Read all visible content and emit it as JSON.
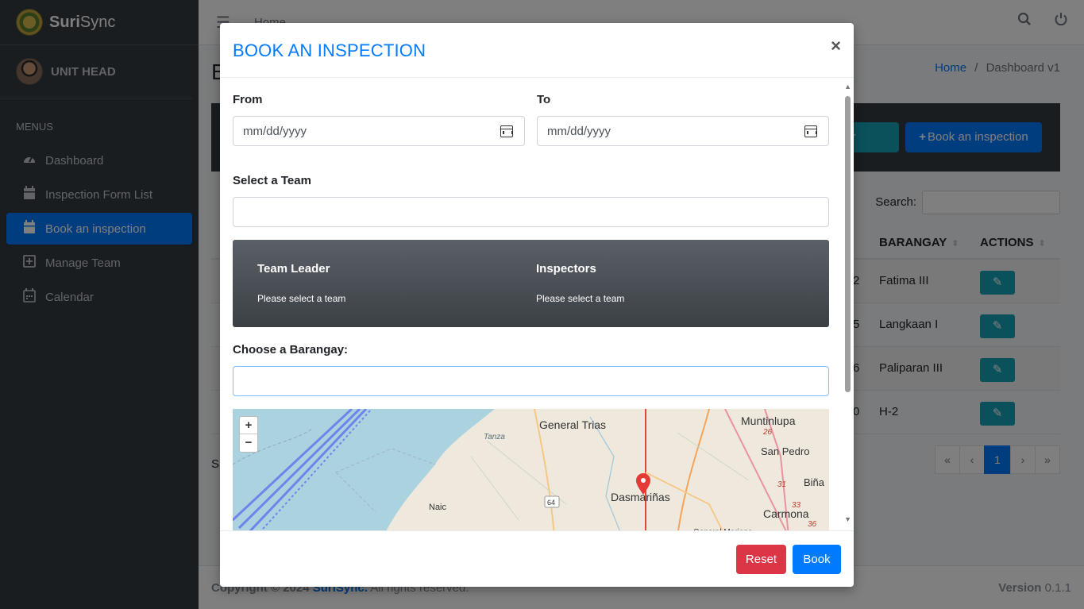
{
  "app": {
    "brand_prefix": "Suri",
    "brand_suffix": "Sync",
    "user_role": "UNIT HEAD"
  },
  "sidebar": {
    "menu_header": "MENUS",
    "items": [
      {
        "label": "Dashboard",
        "icon": "gauge-icon"
      },
      {
        "label": "Inspection Form List",
        "icon": "calendar-icon"
      },
      {
        "label": "Book an inspection",
        "icon": "calendar-icon",
        "active": true
      },
      {
        "label": "Manage Team",
        "icon": "plus-square-icon"
      },
      {
        "label": "Calendar",
        "icon": "calendar-icon"
      }
    ]
  },
  "topbar": {
    "home_label": "Home"
  },
  "page": {
    "title_initial": "B",
    "breadcrumb_home": "Home",
    "breadcrumb_sep": "/",
    "breadcrumb_current": "Dashboard v1",
    "calendar_button_partial": "lendar",
    "book_button": "Book an inspection",
    "search_label": "Search:",
    "table": {
      "headers": [
        "BARANGAY",
        "ACTIONS"
      ],
      "rows": [
        {
          "num_tail": "2",
          "barangay": "Fatima III"
        },
        {
          "num_tail": "5",
          "barangay": "Langkaan I"
        },
        {
          "num_tail": "6",
          "barangay": "Paliparan III"
        },
        {
          "num_tail": "0",
          "barangay": "H-2"
        }
      ]
    },
    "show_partial": "Sl",
    "pager": [
      "«",
      "‹",
      "1",
      "›",
      "»"
    ]
  },
  "footer": {
    "copyright": "Copyright © 2024 ",
    "brand": "SuriSync.",
    "rights": " All rights reserved.",
    "version_label": "Version",
    "version_value": " 0.1.1"
  },
  "modal": {
    "title": "BOOK AN INSPECTION",
    "close": "×",
    "from_label": "From",
    "to_label": "To",
    "from_placeholder": "mm/dd/yyyy",
    "to_placeholder": "mm/dd/yyyy",
    "team_label": "Select a Team",
    "team_value": "",
    "team_leader_heading": "Team Leader",
    "team_leader_value": "Please select a team",
    "inspectors_heading": "Inspectors",
    "inspectors_value": "Please select a team",
    "barangay_label": "Choose a Barangay:",
    "barangay_value": "",
    "map": {
      "zoom_in": "+",
      "zoom_out": "−",
      "places": [
        "General Trias",
        "Muntinlupa",
        "San Pedro",
        "Dasmariñas",
        "Carmona",
        "Naic",
        "Tanza",
        "Biña",
        "General Mariano"
      ],
      "road_numbers": [
        "64",
        "26",
        "31",
        "33",
        "36"
      ]
    },
    "reset_button": "Reset",
    "book_button": "Book"
  }
}
